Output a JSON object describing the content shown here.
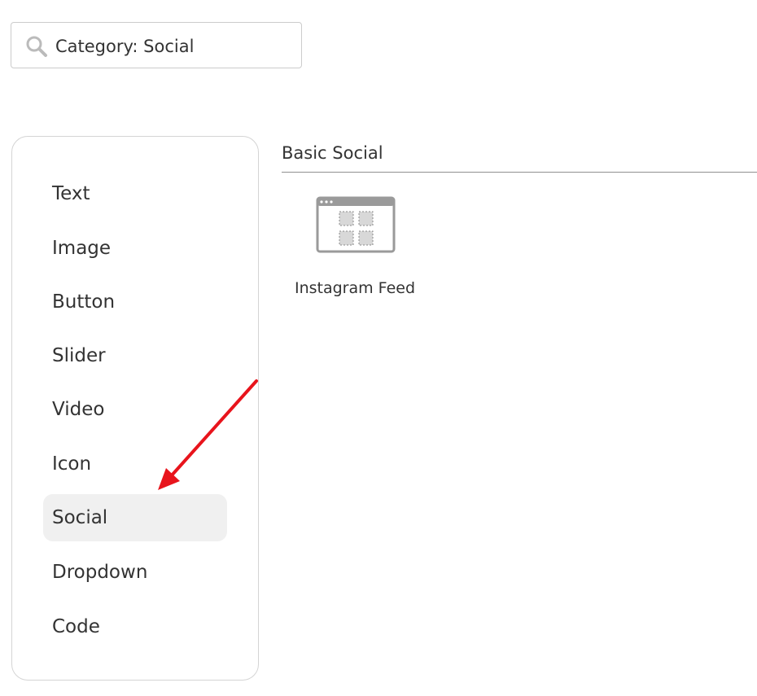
{
  "search": {
    "value": "Category: Social"
  },
  "sidebar": {
    "items": [
      {
        "label": "Text",
        "active": false
      },
      {
        "label": "Image",
        "active": false
      },
      {
        "label": "Button",
        "active": false
      },
      {
        "label": "Slider",
        "active": false
      },
      {
        "label": "Video",
        "active": false
      },
      {
        "label": "Icon",
        "active": false
      },
      {
        "label": "Social",
        "active": true
      },
      {
        "label": "Dropdown",
        "active": false
      },
      {
        "label": "Code",
        "active": false
      }
    ]
  },
  "main": {
    "section_title": "Basic Social",
    "widgets": [
      {
        "label": "Instagram Feed",
        "icon": "grid-feed-icon"
      }
    ]
  },
  "colors": {
    "annotation_arrow": "#e8141c",
    "active_item_bg": "#f0f0f0",
    "icon_gray": "#9a9a9a"
  }
}
